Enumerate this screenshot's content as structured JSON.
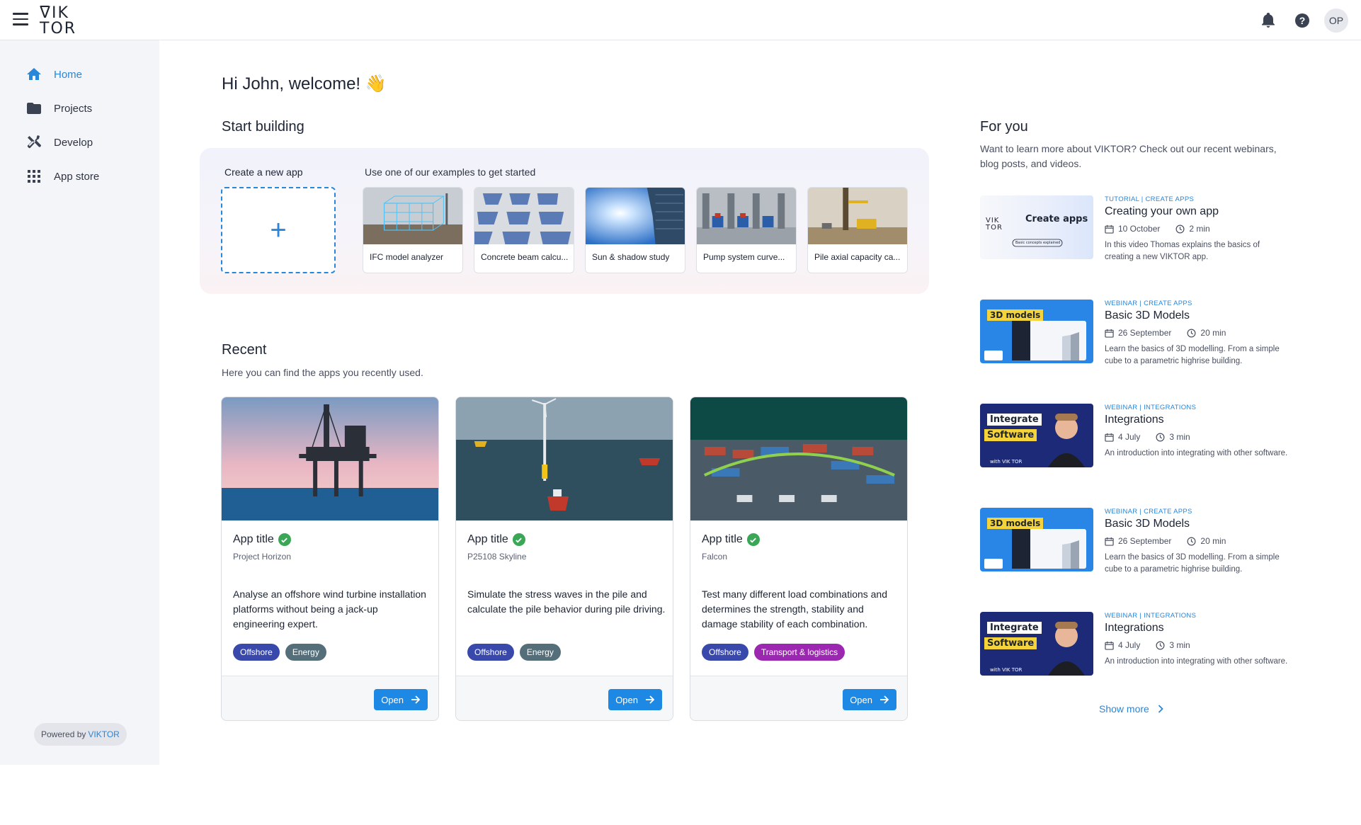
{
  "header": {
    "logo": {
      "line1": "VIK",
      "line2": "TOR"
    },
    "avatar_initials": "OP",
    "icons": [
      "menu-icon",
      "bell-icon",
      "help-icon"
    ]
  },
  "sidebar": {
    "items": [
      {
        "label": "Home",
        "icon": "home-icon",
        "active": true
      },
      {
        "label": "Projects",
        "icon": "folder-icon"
      },
      {
        "label": "Develop",
        "icon": "tools-icon"
      },
      {
        "label": "App store",
        "icon": "grid-icon"
      }
    ],
    "powered_prefix": "Powered by",
    "powered_brand": "VIKTOR"
  },
  "main": {
    "welcome": "Hi John, welcome! 👋",
    "start_building": {
      "title": "Start building",
      "create_label": "Create a new app",
      "examples_label": "Use one of our examples to get started",
      "examples": [
        {
          "label": "IFC model analyzer"
        },
        {
          "label": "Concrete beam calcu..."
        },
        {
          "label": "Sun & shadow study"
        },
        {
          "label": "Pump system curve..."
        },
        {
          "label": "Pile axial capacity ca..."
        }
      ]
    },
    "recent": {
      "title": "Recent",
      "subtitle": "Here you can find the apps you recently used.",
      "open_label": "Open",
      "apps": [
        {
          "title": "App title",
          "project": "Project Horizon",
          "description": "Analyse an offshore wind turbine installation platforms without being a jack-up engineering expert.",
          "tags": [
            {
              "label": "Offshore",
              "color": "#3949ab"
            },
            {
              "label": "Energy",
              "color": "#546e7a"
            }
          ]
        },
        {
          "title": "App title",
          "project": "P25108 Skyline",
          "description": "Simulate the stress waves in the pile and calculate the pile behavior during pile driving.",
          "tags": [
            {
              "label": "Offshore",
              "color": "#3949ab"
            },
            {
              "label": "Energy",
              "color": "#546e7a"
            }
          ]
        },
        {
          "title": "App title",
          "project": "Falcon",
          "description": "Test many different load combinations and determines the strength, stability and damage stability of each combination.",
          "tags": [
            {
              "label": "Offshore",
              "color": "#3949ab"
            },
            {
              "label": "Transport & logistics",
              "color": "#9c27b0"
            }
          ]
        }
      ]
    }
  },
  "for_you": {
    "title": "For you",
    "intro": "Want to learn more about VIKTOR? Check out our recent webinars, blog posts, and videos.",
    "items": [
      {
        "category": "TUTORIAL  |  CREATE APPS",
        "title": "Creating your own app",
        "date": "10 October",
        "duration": "2 min",
        "description": "In this video Thomas explains the basics of creating a new VIKTOR app.",
        "thumb_text": "Create apps",
        "thumb_sub": "Basic concepts explained"
      },
      {
        "category": "WEBINAR  |  CREATE APPS",
        "title": "Basic 3D Models",
        "date": "26 September",
        "duration": "20 min",
        "description": "Learn the basics of 3D modelling. From a simple cube to a parametric highrise building.",
        "thumb_text": "3D models"
      },
      {
        "category": "WEBINAR  |  INTEGRATIONS",
        "title": "Integrations",
        "date": "4 July",
        "duration": "3 min",
        "description": "An introduction into integrating with other software.",
        "thumb_text": "Integrate",
        "thumb_text2": "Software"
      },
      {
        "category": "WEBINAR  |  CREATE APPS",
        "title": "Basic 3D Models",
        "date": "26 September",
        "duration": "20 min",
        "description": "Learn the basics of 3D modelling. From a simple cube to a parametric highrise building.",
        "thumb_text": "3D models"
      },
      {
        "category": "WEBINAR  |  INTEGRATIONS",
        "title": "Integrations",
        "date": "4 July",
        "duration": "3 min",
        "description": "An introduction into integrating with other software.",
        "thumb_text": "Integrate",
        "thumb_text2": "Software"
      }
    ],
    "show_more": "Show more"
  },
  "colors": {
    "accent": "#2a86d8",
    "button": "#1e88e5",
    "verified": "#3aa757"
  }
}
